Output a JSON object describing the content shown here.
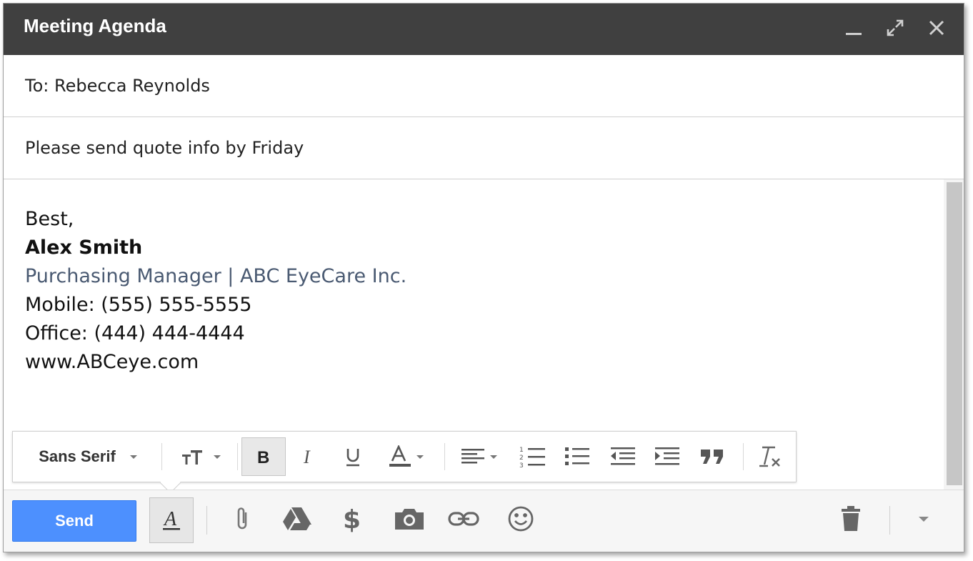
{
  "window": {
    "title": "Meeting Agenda"
  },
  "titlebar_icons": [
    "minimize-icon",
    "expand-icon",
    "close-icon"
  ],
  "to_field": {
    "value": "To: Rebecca Reynolds"
  },
  "subject_field": {
    "value": "Please send quote info by Friday"
  },
  "body": {
    "closing": "Best,",
    "name": "Alex Smith",
    "role": "Purchasing Manager | ABC EyeCare Inc.",
    "mobile": "Mobile: (555) 555-5555",
    "office": "Office: (444) 444-4444",
    "website": "www.ABCeye.com"
  },
  "format_toolbar": {
    "font": "Sans Serif",
    "tools": [
      "text-size-icon",
      "bold-icon",
      "italic-icon",
      "underline-icon",
      "text-color-icon",
      "align-icon",
      "numbered-list-icon",
      "bulleted-list-icon",
      "indent-less-icon",
      "indent-more-icon",
      "quote-icon",
      "remove-formatting-icon"
    ]
  },
  "bottom_bar": {
    "send_label": "Send",
    "icons": [
      "formatting-icon",
      "attach-icon",
      "drive-icon",
      "dollar-icon",
      "camera-icon",
      "link-icon",
      "emoji-icon",
      "trash-icon",
      "more-options-icon"
    ]
  },
  "colors": {
    "titlebar": "#404040",
    "send_button": "#4d90fe",
    "signature_role": "#4a5a72"
  }
}
